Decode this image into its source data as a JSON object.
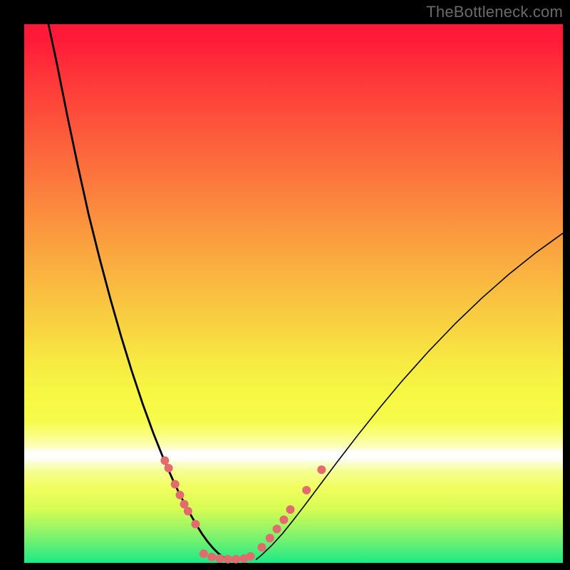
{
  "watermark": "TheBottleneck.com",
  "chart_data": {
    "type": "line",
    "title": "",
    "xlabel": "",
    "ylabel": "",
    "xlim": [
      0,
      100
    ],
    "ylim": [
      0,
      100
    ],
    "note": "Axes unlabeled; x and y read as percentage of plot width/height from bottom-left. Two black curves form a V; salmon markers cluster near the trough.",
    "series": [
      {
        "name": "curve-left",
        "x": [
          4.5,
          6,
          8,
          10,
          12,
          14,
          16,
          18,
          20,
          22,
          24,
          26,
          28,
          30,
          32,
          33,
          34,
          35,
          36,
          37,
          38
        ],
        "y": [
          100,
          93,
          83,
          73.5,
          64.5,
          56.5,
          49,
          42,
          35.5,
          29.5,
          24,
          19,
          14.5,
          10.5,
          7,
          5.4,
          4,
          2.8,
          1.8,
          1,
          0.4
        ]
      },
      {
        "name": "curve-right",
        "x": [
          43,
          44,
          46,
          48,
          50,
          52,
          55,
          58,
          62,
          66,
          70,
          75,
          80,
          85,
          90,
          95,
          100
        ],
        "y": [
          0.6,
          1.4,
          3.3,
          5.5,
          8,
          10.6,
          14.6,
          18.6,
          23.8,
          28.8,
          33.6,
          39.2,
          44.4,
          49.2,
          53.6,
          57.6,
          61.2
        ]
      }
    ],
    "markers_left": [
      {
        "x": 26.1,
        "y": 19.0,
        "r": 6
      },
      {
        "x": 26.8,
        "y": 17.6,
        "r": 6
      },
      {
        "x": 28.0,
        "y": 14.6,
        "r": 6
      },
      {
        "x": 28.9,
        "y": 12.6,
        "r": 6
      },
      {
        "x": 29.7,
        "y": 10.9,
        "r": 6
      },
      {
        "x": 30.4,
        "y": 9.6,
        "r": 6
      },
      {
        "x": 31.8,
        "y": 7.2,
        "r": 6
      }
    ],
    "markers_bottom": [
      {
        "x": 33.3,
        "y": 1.7,
        "r": 6
      },
      {
        "x": 34.8,
        "y": 1.1,
        "r": 6
      },
      {
        "x": 36.3,
        "y": 0.8,
        "r": 6
      },
      {
        "x": 37.8,
        "y": 0.7,
        "r": 6
      },
      {
        "x": 39.3,
        "y": 0.7,
        "r": 6
      },
      {
        "x": 40.8,
        "y": 0.8,
        "r": 6
      },
      {
        "x": 42.0,
        "y": 1.2,
        "r": 6
      }
    ],
    "markers_right": [
      {
        "x": 44.1,
        "y": 2.9,
        "r": 6
      },
      {
        "x": 45.6,
        "y": 4.6,
        "r": 6
      },
      {
        "x": 46.9,
        "y": 6.3,
        "r": 6
      },
      {
        "x": 48.2,
        "y": 8.0,
        "r": 6
      },
      {
        "x": 49.4,
        "y": 9.9,
        "r": 6
      },
      {
        "x": 52.4,
        "y": 13.5,
        "r": 6
      },
      {
        "x": 55.2,
        "y": 17.3,
        "r": 6
      }
    ]
  }
}
